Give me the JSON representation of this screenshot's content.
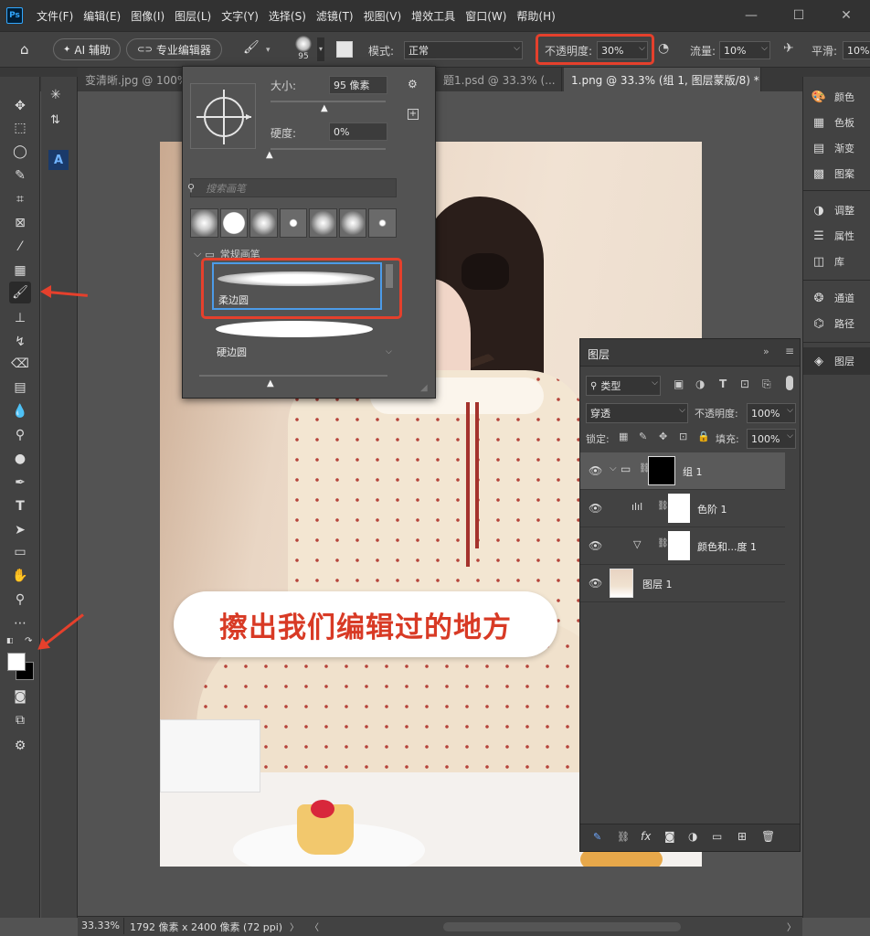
{
  "app": {
    "logo": "Ps"
  },
  "menu": [
    "文件(F)",
    "编辑(E)",
    "图像(I)",
    "图层(L)",
    "文字(Y)",
    "选择(S)",
    "滤镜(T)",
    "视图(V)",
    "增效工具",
    "窗口(W)",
    "帮助(H)"
  ],
  "window_controls": [
    "—",
    "☐",
    "✕"
  ],
  "options": {
    "ai_assist": "AI 辅助",
    "pro_editor": "专业编辑器",
    "brush_size": "95",
    "mode_label": "模式:",
    "mode_value": "正常",
    "opacity_label": "不透明度:",
    "opacity_value": "30%",
    "flow_label": "流量:",
    "flow_value": "10%",
    "smooth_label": "平滑:",
    "smooth_value": "10%"
  },
  "tabs": [
    {
      "label": "变清晰.jpg @ 100%"
    },
    {
      "label": "题1.psd @ 33.3% (..."
    },
    {
      "label": "1.png @ 33.3% (组 1, 图层蒙版/8) *"
    }
  ],
  "brush_popup": {
    "size_label": "大小:",
    "size_value": "95 像素",
    "hardness_label": "硬度:",
    "hardness_value": "0%",
    "search_placeholder": "搜索画笔",
    "folder_label": "常规画笔",
    "brush1_label": "柔边圆",
    "brush2_label": "硬边圆"
  },
  "canvas_caption": "擦出我们编辑过的地方",
  "right_dock": {
    "group1": [
      "颜色",
      "色板",
      "渐变",
      "图案"
    ],
    "group2": [
      "调整",
      "属性",
      "库"
    ],
    "group3": [
      "通道",
      "路径"
    ],
    "group4": [
      "图层"
    ]
  },
  "layers_panel": {
    "title": "图层",
    "kind_label": "类型",
    "blend_mode": "穿透",
    "opacity_label": "不透明度:",
    "opacity_value": "100%",
    "lock_label": "锁定:",
    "fill_label": "填充:",
    "fill_value": "100%",
    "layers": [
      {
        "name": "组 1"
      },
      {
        "name": "色阶 1"
      },
      {
        "name": "颜色和...度 1"
      },
      {
        "name": "图层 1"
      }
    ],
    "bottom_icons": [
      "link-icon",
      "fx",
      "mask-icon",
      "adjustment-icon",
      "folder-icon",
      "new-layer-icon",
      "trash-icon"
    ]
  },
  "status": {
    "zoom": "33.33%",
    "doc_info": "1792 像素 x 2400 像素 (72 ppi)"
  }
}
